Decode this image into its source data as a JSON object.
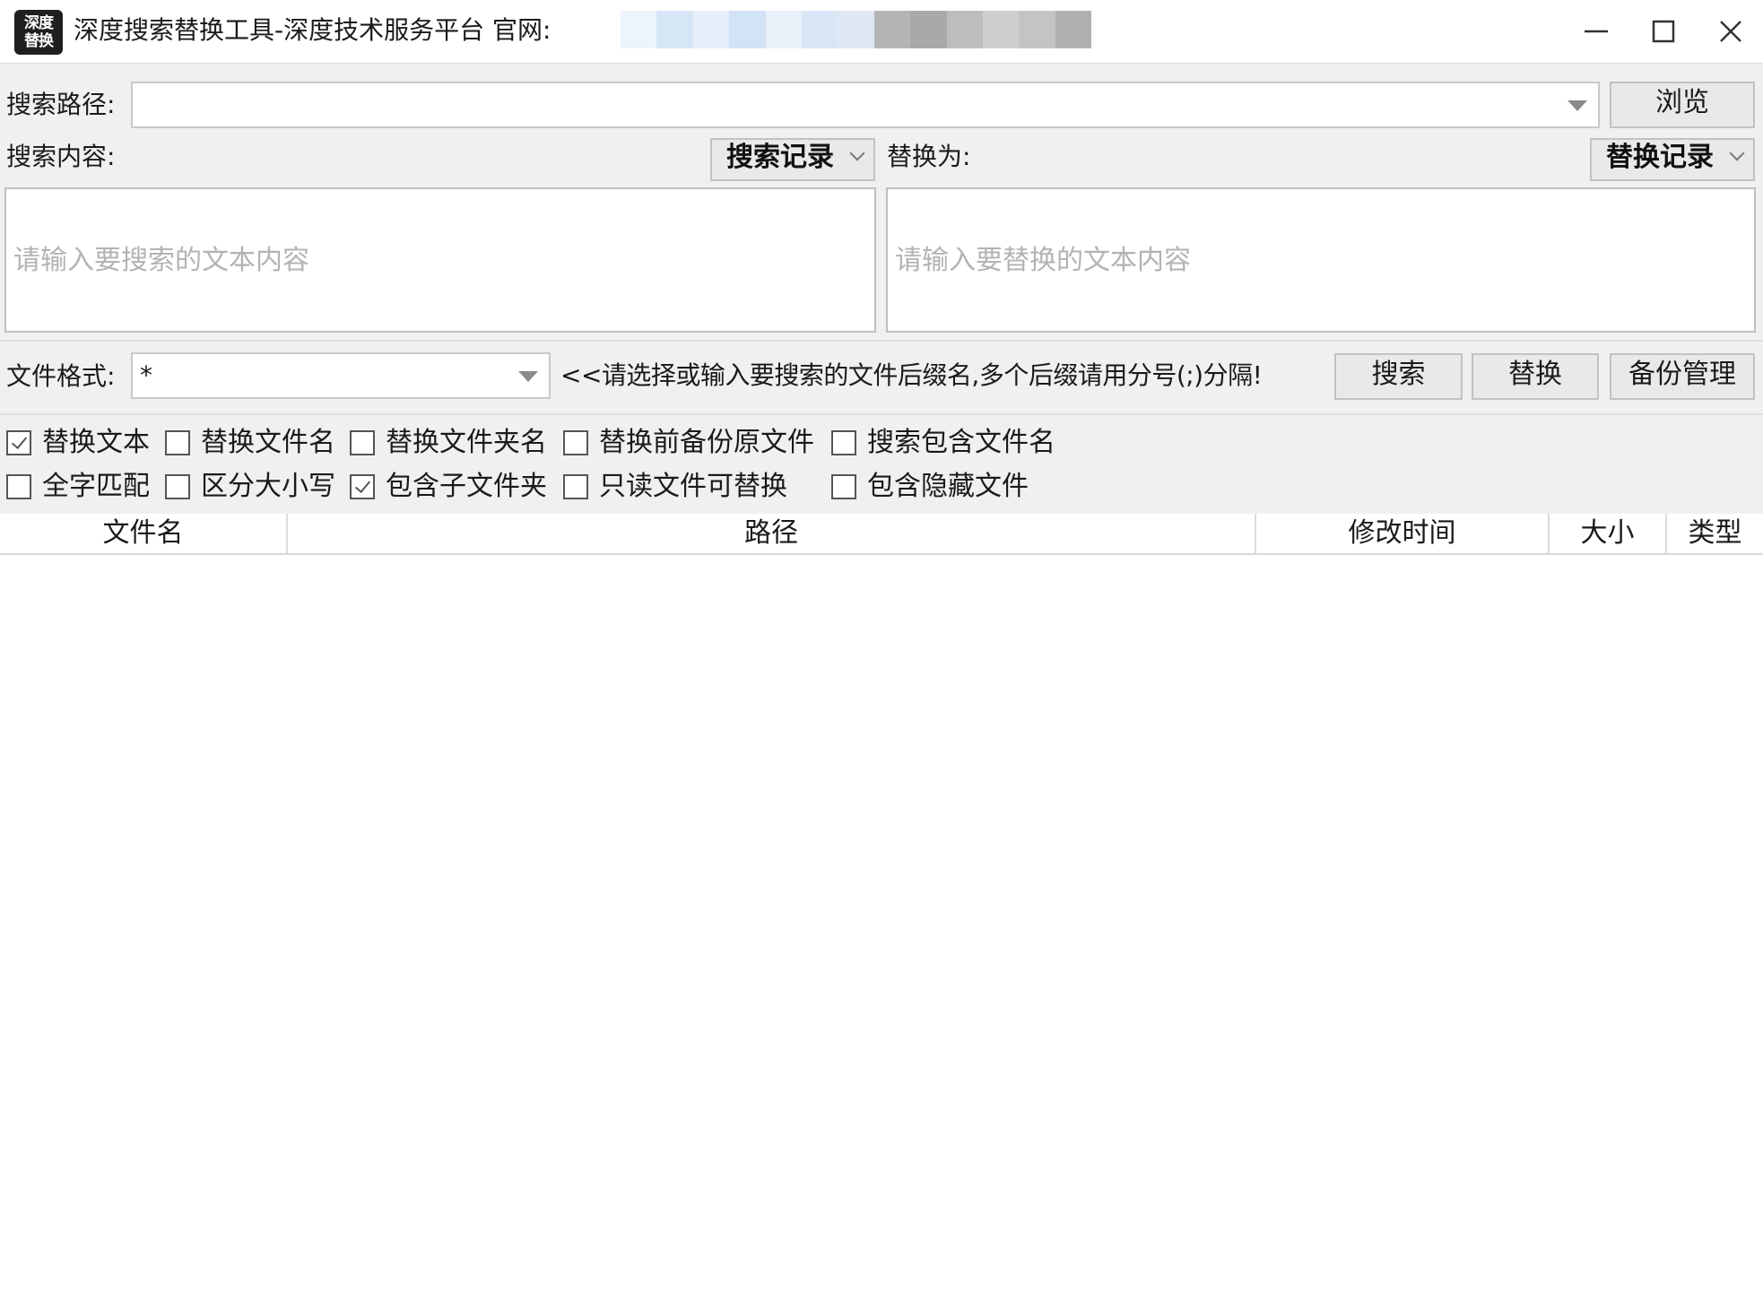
{
  "titlebar": {
    "logo_line1": "深度",
    "logo_line2": "替换",
    "title": "深度搜索替换工具-深度技术服务平台 官网:",
    "controls": {
      "minimize": "minimize-icon",
      "maximize": "maximize-icon",
      "close": "close-icon"
    }
  },
  "search_path": {
    "label": "搜索路径:",
    "value": "",
    "browse_button": "浏览"
  },
  "search_content": {
    "label": "搜索内容:",
    "history_button": "搜索记录",
    "placeholder": "请输入要搜索的文本内容"
  },
  "replace_content": {
    "label": "替换为:",
    "history_button": "替换记录",
    "placeholder": "请输入要替换的文本内容"
  },
  "file_format": {
    "label": "文件格式:",
    "value": "*",
    "hint": "<<请选择或输入要搜索的文件后缀名,多个后缀请用分号(;)分隔!"
  },
  "actions": {
    "search": "搜索",
    "replace": "替换",
    "backup": "备份管理"
  },
  "options": {
    "replace_text": {
      "label": "替换文本",
      "checked": true
    },
    "replace_filename": {
      "label": "替换文件名",
      "checked": false
    },
    "replace_foldername": {
      "label": "替换文件夹名",
      "checked": false
    },
    "backup_before": {
      "label": "替换前备份原文件",
      "checked": false
    },
    "search_filename": {
      "label": "搜索包含文件名",
      "checked": false
    },
    "whole_word": {
      "label": "全字匹配",
      "checked": false
    },
    "case_sensitive": {
      "label": "区分大小写",
      "checked": false
    },
    "include_subfolders": {
      "label": "包含子文件夹",
      "checked": true
    },
    "readonly_replace": {
      "label": "只读文件可替换",
      "checked": false
    },
    "include_hidden": {
      "label": "包含隐藏文件",
      "checked": false
    }
  },
  "table": {
    "columns": [
      "文件名",
      "路径",
      "修改时间",
      "大小",
      "类型"
    ],
    "rows": []
  },
  "colors": {
    "panel_bg": "#f0f0f0",
    "button_bg": "#e9e9e9",
    "border": "#c2c2c2",
    "placeholder": "#b3b3b3"
  }
}
